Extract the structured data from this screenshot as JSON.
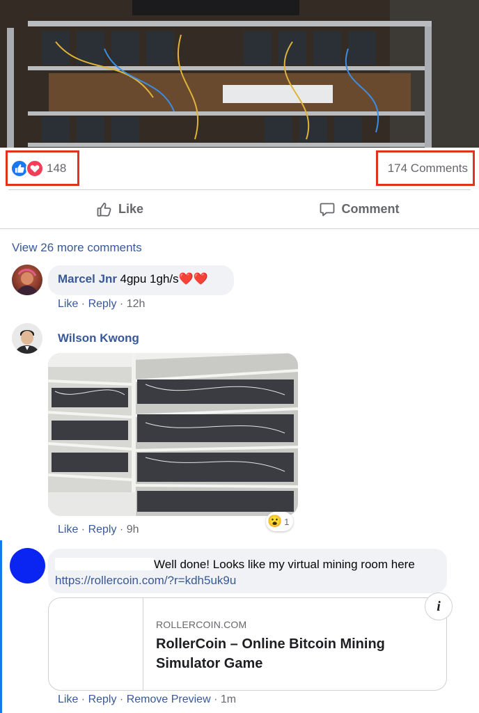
{
  "post": {
    "reaction_count": "148",
    "reaction_icons": [
      "like-icon",
      "love-icon"
    ],
    "comments_count": "174 Comments"
  },
  "actions": {
    "like_label": "Like",
    "comment_label": "Comment"
  },
  "view_more": "View 26 more comments",
  "comments": [
    {
      "author": "Marcel Jnr",
      "text": "4gpu 1gh/s",
      "emoji": "❤️❤️",
      "like": "Like",
      "reply": "Reply",
      "time": "12h"
    },
    {
      "author": "Wilson Kwong",
      "like": "Like",
      "reply": "Reply",
      "time": "9h",
      "reaction_emoji": "😮",
      "reaction_count": "1"
    },
    {
      "author": "",
      "text": "Well done! Looks like my virtual mining room here",
      "link": "https://rollercoin.com/?r=kdh5uk9u",
      "preview": {
        "domain": "ROLLERCOIN.COM",
        "title": "RollerCoin – Online Bitcoin Mining Simulator Game",
        "info_icon": "i"
      },
      "like": "Like",
      "reply": "Reply",
      "remove_preview": "Remove Preview",
      "time": "1m"
    }
  ],
  "colors": {
    "link_blue": "#385898",
    "facebook_blue": "#1877f2",
    "highlight_red": "#e0321e",
    "bubble_gray": "#f0f2f5",
    "muted_text": "#65676b"
  }
}
